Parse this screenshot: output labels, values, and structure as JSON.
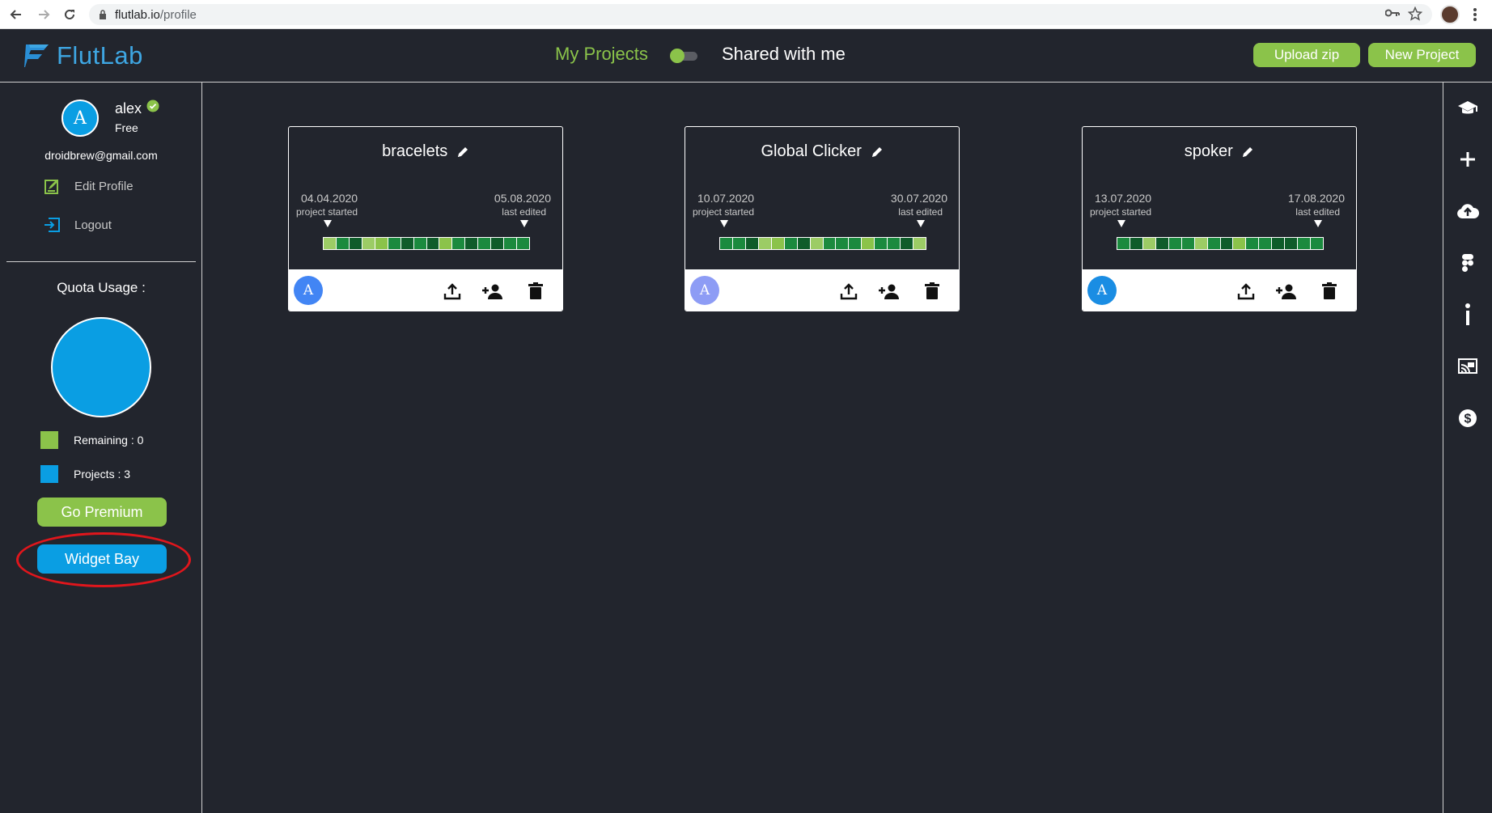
{
  "browser": {
    "url_host": "flutlab.io",
    "url_path": "/profile"
  },
  "header": {
    "logo_text": "FlutLab",
    "tab_my_projects": "My Projects",
    "tab_shared": "Shared with me",
    "upload_zip": "Upload zip",
    "new_project": "New Project"
  },
  "profile": {
    "avatar_letter": "A",
    "username": "alex",
    "plan": "Free",
    "email": "droidbrew@gmail.com",
    "edit_profile": "Edit Profile",
    "logout": "Logout"
  },
  "quota": {
    "title": "Quota Usage :",
    "remaining_label": "Remaining : 0",
    "projects_label": "Projects : 3",
    "remaining": 0,
    "projects": 3,
    "remaining_color": "#8bc34a",
    "projects_color": "#0a9ee3"
  },
  "buttons": {
    "go_premium": "Go Premium",
    "widget_bay": "Widget Bay"
  },
  "colors": {
    "accent_green": "#8bc34a",
    "accent_blue": "#0a9ee3",
    "background": "#22252d",
    "highlight_red": "#e0161c"
  },
  "right_rail_icons": [
    "graduation-cap-icon",
    "plus-icon",
    "cloud-upload-icon",
    "figma-icon",
    "info-icon",
    "cast-icon",
    "dollar-icon"
  ],
  "projects": [
    {
      "name": "bracelets",
      "started_date": "04.04.2020",
      "started_label": "project started",
      "edited_date": "05.08.2020",
      "edited_label": "last edited",
      "avatar_letter": "A",
      "avatar_color": "#4285f4",
      "activity": [
        "#9ccc65",
        "#1b8a3e",
        "#0f5c2a",
        "#9ccc65",
        "#8bc34a",
        "#1b8a3e",
        "#0f5c2a",
        "#1b8a3e",
        "#0f5c2a",
        "#8bc34a",
        "#1b8a3e",
        "#0f5c2a",
        "#1b8a3e",
        "#0f5c2a",
        "#1b8a3e",
        "#1b8a3e"
      ]
    },
    {
      "name": "Global Clicker",
      "started_date": "10.07.2020",
      "started_label": "project started",
      "edited_date": "30.07.2020",
      "edited_label": "last edited",
      "avatar_letter": "A",
      "avatar_color": "#8d9cf5",
      "activity": [
        "#1b8a3e",
        "#1b8a3e",
        "#0f5c2a",
        "#9ccc65",
        "#8bc34a",
        "#1b8a3e",
        "#0f5c2a",
        "#9ccc65",
        "#1b8a3e",
        "#1b8a3e",
        "#1b8a3e",
        "#8bc34a",
        "#1b8a3e",
        "#1b8a3e",
        "#0f5c2a",
        "#9ccc65"
      ]
    },
    {
      "name": "spoker",
      "started_date": "13.07.2020",
      "started_label": "project started",
      "edited_date": "17.08.2020",
      "edited_label": "last edited",
      "avatar_letter": "A",
      "avatar_color": "#1a8de3",
      "activity": [
        "#1b8a3e",
        "#0f5c2a",
        "#9ccc65",
        "#0f5c2a",
        "#1b8a3e",
        "#1b8a3e",
        "#9ccc65",
        "#1b8a3e",
        "#0f5c2a",
        "#8bc34a",
        "#1b8a3e",
        "#1b8a3e",
        "#0f5c2a",
        "#0f5c2a",
        "#1b8a3e",
        "#1b8a3e"
      ]
    }
  ]
}
